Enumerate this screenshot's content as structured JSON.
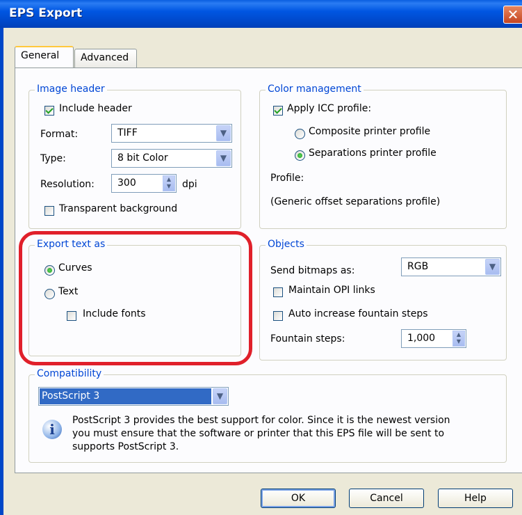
{
  "window": {
    "title": "EPS Export",
    "close_glyph": "✕"
  },
  "tabs": [
    {
      "label": "General",
      "active": true
    },
    {
      "label": "Advanced",
      "active": false
    }
  ],
  "image_header": {
    "legend": "Image header",
    "include_header": {
      "label": "Include header",
      "checked": true
    },
    "format": {
      "label": "Format:",
      "value": "TIFF"
    },
    "type": {
      "label": "Type:",
      "value": "8 bit Color"
    },
    "resolution": {
      "label": "Resolution:",
      "value": "300",
      "unit": "dpi"
    },
    "transparent_background": {
      "label": "Transparent background",
      "checked": false
    }
  },
  "color_management": {
    "legend": "Color management",
    "apply_icc": {
      "label": "Apply ICC profile:",
      "checked": true
    },
    "composite": {
      "label": "Composite printer profile",
      "selected": false
    },
    "separations": {
      "label": "Separations printer profile",
      "selected": true
    },
    "profile_label": "Profile:",
    "profile_value": "(Generic offset separations profile)"
  },
  "export_text": {
    "legend": "Export text as",
    "curves": {
      "label": "Curves",
      "selected": true
    },
    "text": {
      "label": "Text",
      "selected": false
    },
    "include_fonts": {
      "label": "Include fonts",
      "checked": false
    }
  },
  "objects": {
    "legend": "Objects",
    "send_bitmaps": {
      "label": "Send bitmaps as:",
      "value": "RGB"
    },
    "maintain_opi": {
      "label": "Maintain OPI links",
      "checked": false
    },
    "auto_increase": {
      "label": "Auto increase fountain steps",
      "checked": false
    },
    "fountain_steps": {
      "label": "Fountain steps:",
      "value": "1,000"
    }
  },
  "compatibility": {
    "legend": "Compatibility",
    "value": "PostScript 3",
    "info_line1": "PostScript 3 provides the best support for color. Since it is the newest version",
    "info_line2": "you must ensure that the software or printer that this EPS file will be sent to",
    "info_line3": "supports PostScript 3."
  },
  "buttons": {
    "ok": "OK",
    "cancel": "Cancel",
    "help": "Help"
  },
  "colors": {
    "titlebar": "#0054e3",
    "legend_text": "#0046d5",
    "highlight_ring": "#e0202a",
    "selection": "#316ac5"
  },
  "icons": {
    "dropdown": "chevron-down-icon",
    "info": "info-icon",
    "close": "close-icon"
  }
}
